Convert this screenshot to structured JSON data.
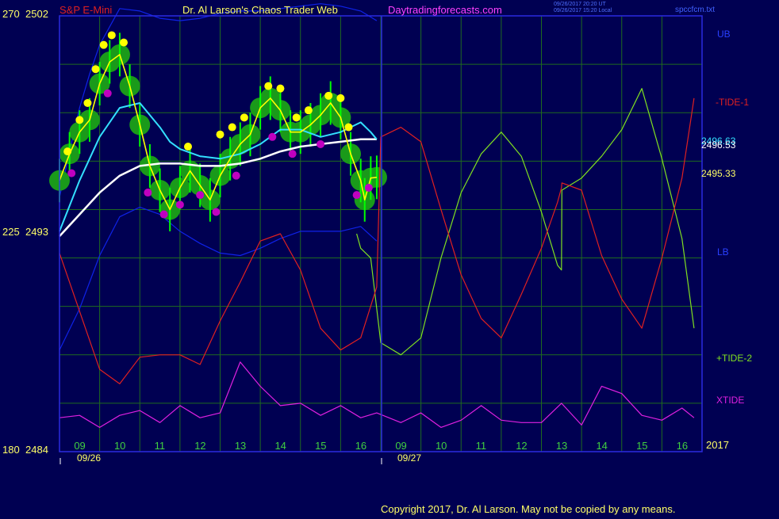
{
  "header": {
    "symbol": "S&P E-Mini",
    "author": "Dr. Al Larson's Chaos Trader Web",
    "site": "Daytradingforecasts.com",
    "file": "spccfcm.txt",
    "times_utc": "09/26/2017 20:20 UT",
    "times_local": "09/26/2017 15:20 Local"
  },
  "footer": {
    "copyright": "Copyright 2017, Dr. Al Larson. May not be copied by any means."
  },
  "colors": {
    "background": "#000052",
    "frame": "#2a2ae0",
    "grid": "#1f6b1f",
    "price": "#ffff00",
    "avg_fast": "#33e0ff",
    "avg_slow": "#ffffff",
    "band": "#0f22e8",
    "tide1": "#e02020",
    "tide2": "#80e020",
    "xtide": "#e020e0",
    "dots_high": "#ffff00",
    "dots_low": "#c000c0",
    "halo": "#1a9a1a",
    "bars": "#00ff00"
  },
  "chart_data": {
    "type": "line",
    "title": "S&P E-Mini",
    "y_left": {
      "ylim": [
        2484,
        2502
      ],
      "tick_labels": [
        {
          "left": "270",
          "right": "2502",
          "price": 2502
        },
        {
          "left": "225",
          "right": "2493",
          "price": 2493
        },
        {
          "left": "180",
          "right": "2484",
          "price": 2484
        }
      ]
    },
    "x_axis": {
      "hour_labels": [
        "09",
        "10",
        "11",
        "12",
        "13",
        "14",
        "15",
        "16",
        "09",
        "10",
        "11",
        "12",
        "13",
        "14",
        "15",
        "16"
      ],
      "date_labels": [
        "09/26",
        "09/27"
      ],
      "year_label": "2017",
      "session_divider_after": "16"
    },
    "right_labels": {
      "UB": "UB",
      "tide1": "-TIDE-1",
      "lb": "LB",
      "tide2": "+TIDE-2",
      "xtide": "XTIDE",
      "price_a": "2496.63",
      "price_b": "2496.53",
      "price_c": "2495.33"
    },
    "series": [
      {
        "name": "UB",
        "x": [
          0,
          0.25,
          0.5,
          0.75,
          1,
          1.5,
          2,
          2.5,
          3,
          3.5,
          4,
          4.5,
          5,
          5.5,
          6,
          6.5,
          7,
          7.5,
          7.9
        ],
        "values": [
          2494.5,
          2496.4,
          2498.2,
          2499.6,
          2500.8,
          2502.3,
          2502.2,
          2501.9,
          2501.8,
          2501.9,
          2502.1,
          2502.2,
          2502.2,
          2502.3,
          2502.4,
          2502.5,
          2502.4,
          2502.2,
          2501.8
        ]
      },
      {
        "name": "LB",
        "x": [
          0,
          0.5,
          1,
          1.5,
          2,
          2.5,
          3,
          3.5,
          4,
          4.5,
          5,
          5.5,
          6,
          6.5,
          7,
          7.5,
          7.9
        ],
        "values": [
          2488.2,
          2489.9,
          2492.1,
          2493.7,
          2494.1,
          2493.8,
          2493.1,
          2492.6,
          2492.2,
          2492.1,
          2492.4,
          2492.8,
          2493.1,
          2493.1,
          2493.1,
          2493.3,
          2492.7
        ]
      },
      {
        "name": "avg_slow",
        "x": [
          0,
          0.5,
          1,
          1.5,
          2,
          2.5,
          3,
          3.5,
          4,
          4.5,
          5,
          5.5,
          6,
          6.5,
          7,
          7.5,
          7.9
        ],
        "values": [
          2492.9,
          2493.8,
          2494.7,
          2495.4,
          2495.8,
          2495.9,
          2495.9,
          2495.8,
          2495.8,
          2495.9,
          2496.1,
          2496.4,
          2496.6,
          2496.7,
          2496.8,
          2496.9,
          2496.9
        ]
      },
      {
        "name": "avg_fast",
        "x": [
          0,
          0.5,
          1,
          1.5,
          2,
          2.5,
          2.75,
          3,
          3.5,
          4,
          4.5,
          5,
          5.5,
          6,
          6.5,
          7,
          7.5,
          7.75,
          7.9
        ],
        "values": [
          2493.1,
          2495.2,
          2497.0,
          2498.2,
          2498.4,
          2497.4,
          2496.8,
          2496.5,
          2496.2,
          2496.1,
          2496.3,
          2496.7,
          2497.3,
          2497.3,
          2497.0,
          2497.2,
          2497.6,
          2497.2,
          2496.9
        ]
      },
      {
        "name": "price",
        "x": [
          0,
          0.25,
          0.5,
          0.75,
          1,
          1.25,
          1.5,
          1.75,
          2,
          2.25,
          2.5,
          2.75,
          3,
          3.25,
          3.5,
          3.75,
          4,
          4.25,
          4.5,
          4.75,
          5,
          5.25,
          5.5,
          5.75,
          6,
          6.25,
          6.5,
          6.75,
          7,
          7.25,
          7.5,
          7.6,
          7.75,
          7.9
        ],
        "values": [
          2495.2,
          2496.3,
          2497.2,
          2497.7,
          2499.2,
          2500.1,
          2500.4,
          2499.1,
          2497.5,
          2495.8,
          2494.8,
          2494.0,
          2494.9,
          2495.6,
          2495.0,
          2494.4,
          2495.4,
          2496.1,
          2496.7,
          2497.1,
          2498.2,
          2498.6,
          2498.1,
          2497.2,
          2497.2,
          2497.5,
          2497.9,
          2498.4,
          2497.8,
          2496.3,
          2495.2,
          2494.4,
          2495.3,
          2495.33
        ]
      },
      {
        "name": "+TIDE-2",
        "x": [
          7.4,
          7.5,
          7.75,
          8,
          8.5,
          9,
          9.5,
          10,
          10.5,
          11,
          11.5,
          12,
          12.4,
          12.5,
          12.51,
          13,
          13.5,
          14,
          14.5,
          15,
          15.5,
          15.8
        ],
        "values": [
          2493.0,
          2492.4,
          2492.0,
          2488.5,
          2488.0,
          2488.7,
          2492.0,
          2494.7,
          2496.3,
          2497.2,
          2496.2,
          2493.9,
          2491.7,
          2491.5,
          2494.8,
          2495.3,
          2496.2,
          2497.3,
          2499.0,
          2496.1,
          2492.8,
          2489.1
        ]
      },
      {
        "name": "-TIDE-1",
        "x": [
          0,
          0.5,
          1,
          1.5,
          2,
          2.5,
          3,
          3.5,
          4,
          4.5,
          5,
          5.5,
          6,
          6.5,
          7,
          7.5,
          7.9,
          8,
          8.5,
          9,
          9.5,
          10,
          10.5,
          11,
          11.5,
          12,
          12.4,
          12.5,
          12.51,
          13,
          13.5,
          14,
          14.5,
          15,
          15.5,
          15.8
        ],
        "values": [
          2492.2,
          2489.8,
          2487.4,
          2486.8,
          2487.9,
          2488.0,
          2488.0,
          2487.6,
          2489.4,
          2491.0,
          2492.7,
          2493.0,
          2491.5,
          2489.1,
          2488.2,
          2488.7,
          2490.8,
          2497.0,
          2497.4,
          2496.8,
          2494.0,
          2491.3,
          2489.5,
          2488.7,
          2490.5,
          2492.4,
          2494.3,
          2494.9,
          2495.1,
          2494.8,
          2492.1,
          2490.3,
          2489.1,
          2492.0,
          2495.3,
          2498.6
        ]
      },
      {
        "name": "XTIDE",
        "x": [
          0,
          0.5,
          1,
          1.5,
          2,
          2.5,
          3,
          3.5,
          4,
          4.5,
          5,
          5.5,
          6,
          6.5,
          7,
          7.5,
          7.9,
          8.5,
          9,
          9.5,
          10,
          10.5,
          11,
          11.5,
          12,
          12.5,
          13,
          13.5,
          14,
          14.5,
          15,
          15.5,
          15.8
        ],
        "values": [
          2485.4,
          2485.5,
          2485.0,
          2485.5,
          2485.7,
          2485.2,
          2485.9,
          2485.4,
          2485.6,
          2487.7,
          2486.7,
          2485.9,
          2486.0,
          2485.5,
          2485.9,
          2485.4,
          2485.6,
          2485.2,
          2485.6,
          2485.0,
          2485.3,
          2485.9,
          2485.3,
          2485.2,
          2485.2,
          2486.0,
          2485.1,
          2486.7,
          2486.4,
          2485.5,
          2485.3,
          2485.8,
          2485.4
        ]
      }
    ],
    "halo_x": [
      0,
      0.25,
      0.5,
      0.75,
      1,
      1.25,
      1.5,
      1.75,
      2,
      2.25,
      2.5,
      2.75,
      3,
      3.25,
      3.5,
      3.75,
      4,
      4.25,
      4.5,
      4.75,
      5,
      5.25,
      5.5,
      5.75,
      6,
      6.25,
      6.5,
      6.75,
      7,
      7.25,
      7.5,
      7.6,
      7.75,
      7.9
    ],
    "high_dots": [
      [
        0.2,
        2496.4
      ],
      [
        0.5,
        2497.7
      ],
      [
        0.7,
        2498.4
      ],
      [
        0.9,
        2499.8
      ],
      [
        1.1,
        2500.8
      ],
      [
        1.3,
        2501.2
      ],
      [
        1.6,
        2500.9
      ],
      [
        3.2,
        2496.6
      ],
      [
        4.0,
        2497.1
      ],
      [
        4.3,
        2497.4
      ],
      [
        4.6,
        2497.8
      ],
      [
        5.2,
        2499.1
      ],
      [
        5.5,
        2499.0
      ],
      [
        5.9,
        2497.8
      ],
      [
        6.2,
        2498.1
      ],
      [
        6.7,
        2498.7
      ],
      [
        7.0,
        2498.6
      ],
      [
        7.2,
        2497.4
      ]
    ],
    "low_dots": [
      [
        0.3,
        2495.5
      ],
      [
        1.2,
        2498.8
      ],
      [
        2.2,
        2494.7
      ],
      [
        2.6,
        2493.8
      ],
      [
        3.0,
        2494.2
      ],
      [
        3.5,
        2494.6
      ],
      [
        3.9,
        2493.9
      ],
      [
        4.4,
        2495.4
      ],
      [
        5.3,
        2497.0
      ],
      [
        5.8,
        2496.3
      ],
      [
        6.5,
        2496.7
      ],
      [
        7.4,
        2494.6
      ],
      [
        7.7,
        2494.9
      ]
    ]
  }
}
